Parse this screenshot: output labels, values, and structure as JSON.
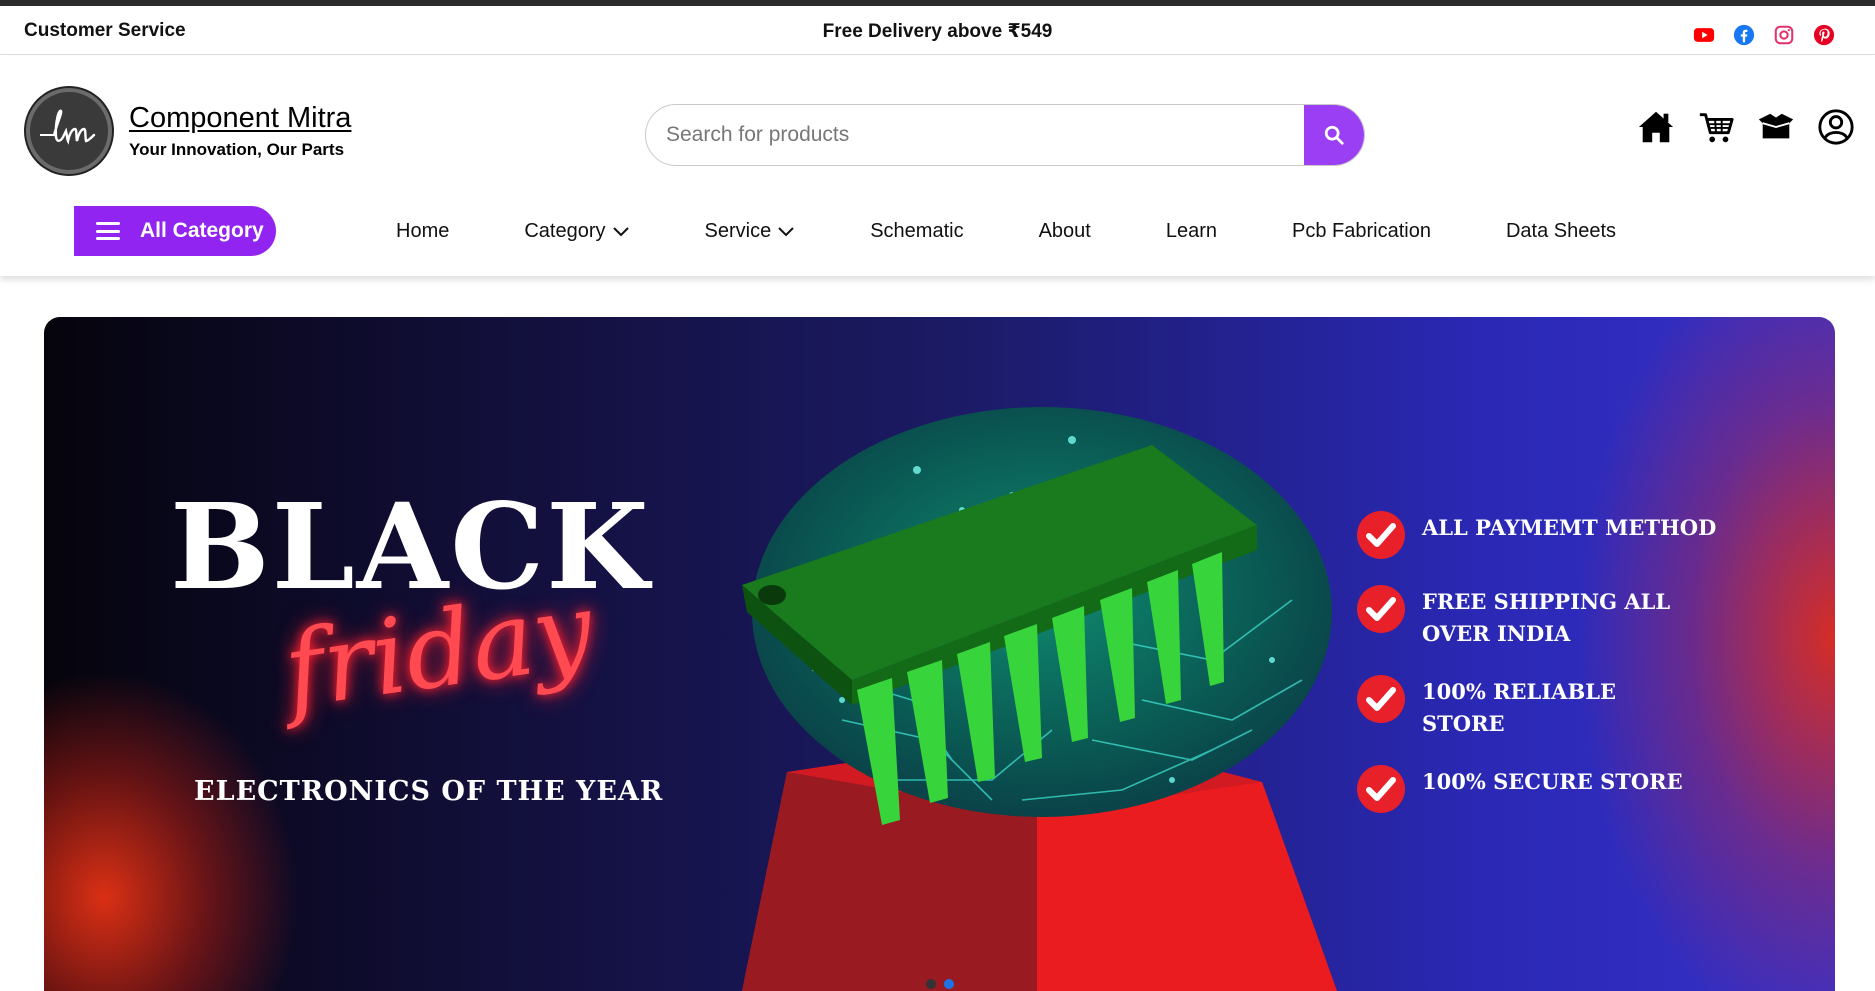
{
  "topbar": {
    "customer_service": "Customer Service",
    "delivery_notice": "Free Delivery above ₹549",
    "socials": [
      "youtube-icon",
      "facebook-icon",
      "instagram-icon",
      "pinterest-icon"
    ]
  },
  "header": {
    "brand_name": "Component Mitra",
    "tagline": "Your Innovation, Our Parts",
    "search_placeholder": "Search for products",
    "icons": [
      "home-icon",
      "cart-icon",
      "orders-box-icon",
      "user-account-icon"
    ]
  },
  "nav": {
    "all_category": "All Category",
    "items": [
      {
        "label": "Home"
      },
      {
        "label": "Category"
      },
      {
        "label": "Service"
      },
      {
        "label": "Schematic"
      },
      {
        "label": "About"
      },
      {
        "label": "Learn"
      },
      {
        "label": "Pcb Fabrication"
      },
      {
        "label": "Data Sheets"
      }
    ]
  },
  "hero": {
    "headline": "BLACK",
    "script": "friday",
    "subtitle": "ELECTRONICS OF THE YEAR",
    "features": [
      "ALL PAYMEMT METHOD",
      "FREE SHIPPING ALL OVER INDIA",
      "100% RELIABLE STORE",
      "100% SECURE STORE"
    ],
    "slide_count": 2,
    "active_slide": 2
  },
  "colors": {
    "accent_purple": "#9124f0",
    "search_button": "#9b3ff5",
    "check_red": "#e8202a",
    "active_dot": "#1e73e8"
  }
}
